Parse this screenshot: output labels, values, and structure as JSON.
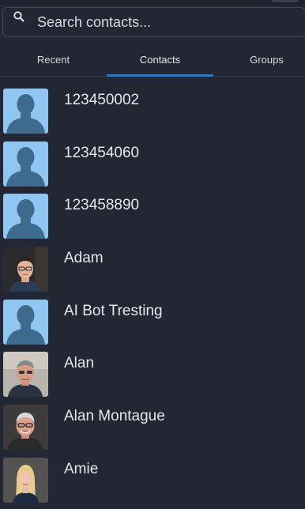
{
  "search": {
    "placeholder": "Search contacts...",
    "icon": "search-icon"
  },
  "tabs": [
    {
      "label": "Recent",
      "active": false
    },
    {
      "label": "Contacts",
      "active": true
    },
    {
      "label": "Groups",
      "active": false
    }
  ],
  "colors": {
    "background": "#232633",
    "accent": "#1e7be0",
    "placeholder_avatar_bg": "#8fc7f2",
    "placeholder_avatar_silhouette": "#3d6a8d"
  },
  "contacts": [
    {
      "name": "123450002",
      "avatar": "default-avatar-icon"
    },
    {
      "name": "123454060",
      "avatar": "default-avatar-icon"
    },
    {
      "name": "123458890",
      "avatar": "default-avatar-icon"
    },
    {
      "name": "Adam",
      "avatar": "photo-avatar"
    },
    {
      "name": "AI Bot Tresting",
      "avatar": "default-avatar-icon"
    },
    {
      "name": "Alan",
      "avatar": "photo-avatar"
    },
    {
      "name": "Alan Montague",
      "avatar": "photo-avatar"
    },
    {
      "name": "Amie",
      "avatar": "photo-avatar"
    }
  ]
}
